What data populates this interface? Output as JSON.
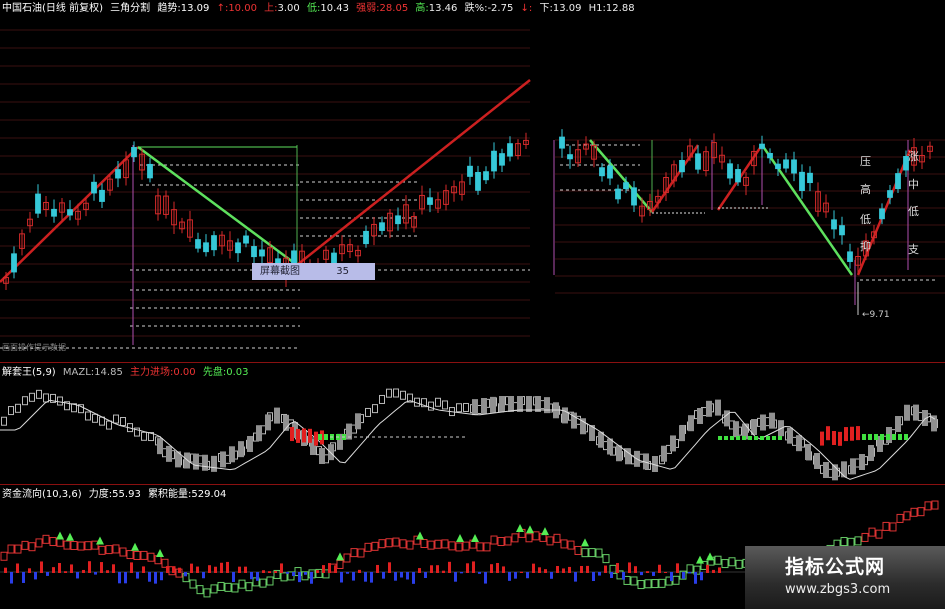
{
  "header": {
    "stock": "中国石油(日线 前复权)",
    "method": "三角分割",
    "trend_label": "趋势:",
    "trend_value": "13.09",
    "up_label": "↑:",
    "up_value": "10.00",
    "up2_label": "上:",
    "up2_value": "3.00",
    "low_label": "低:",
    "low_value": "10.43",
    "strong_label": "强弱:",
    "strong_value": "28.05",
    "high_label": "高:",
    "high_value": "13.46",
    "drop_label": "跌%:",
    "drop_value": "-2.75",
    "down_label": "↓:",
    "down2_label": "下:",
    "down2_value": "13.09",
    "h1_label": "H1:",
    "h1_value": "12.88"
  },
  "ind1": {
    "name": "解套王",
    "params": "(5,9)",
    "mazl_label": "MAZL:",
    "mazl_value": "14.85",
    "main_label": "主力进场:",
    "main_value": "0.00",
    "lead_label": "先盘:",
    "lead_value": "0.03"
  },
  "ind2": {
    "name": "资金流向",
    "params": "(10,3,6)",
    "force_label": "力度:",
    "force_value": "55.93",
    "acc_label": "累积能量:",
    "acc_value": "529.04"
  },
  "tooltip": {
    "label": "屏幕截图",
    "value": "35"
  },
  "low_marker": "←9.71",
  "side_tags": [
    "压",
    "高",
    "低",
    "抑"
  ],
  "side_tags2": [
    "涨",
    "中",
    "低",
    "支"
  ],
  "faint_text": "画面操作提示数据",
  "watermark": {
    "title": "指标公式网",
    "url": "www.zbgs3.com"
  },
  "colors": {
    "up": "#d42a2a",
    "down": "#36c8d8",
    "rise_line": "#cc2020",
    "fall_line": "#5ee05e",
    "grey_bar": "#b8b8b8",
    "positive_bar": "#e02020",
    "negative_bar": "#2a3ee8",
    "separator": "#8a1010"
  }
}
